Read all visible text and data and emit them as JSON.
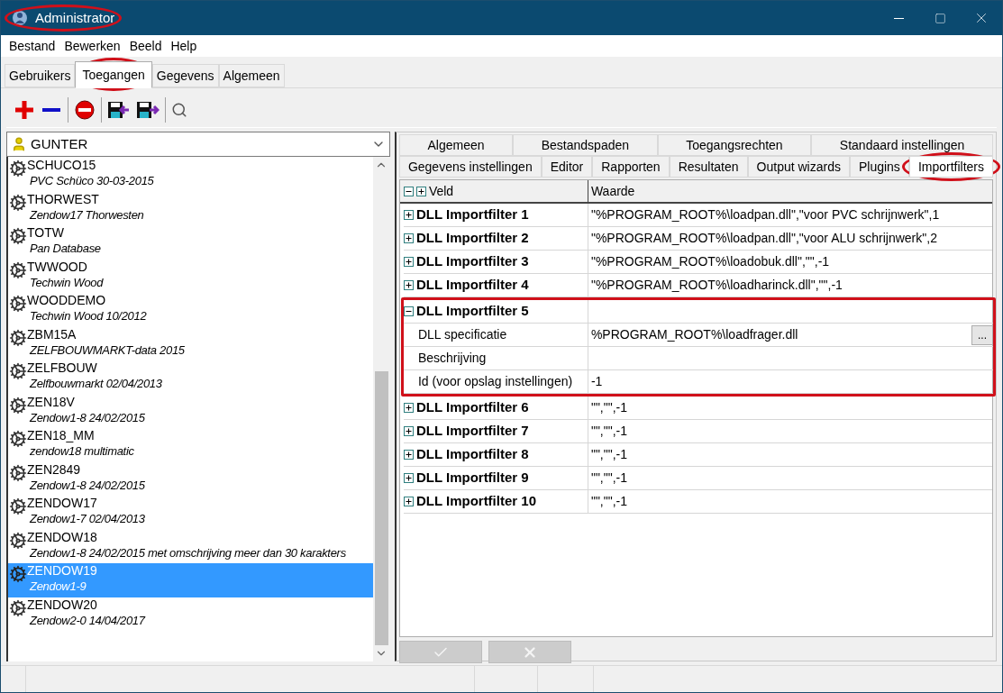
{
  "window": {
    "title": "Administrator",
    "highlighted": true
  },
  "menu": [
    "Bestand",
    "Bewerken",
    "Beeld",
    "Help"
  ],
  "tabs": [
    {
      "label": "Gebruikers",
      "selected": false,
      "highlighted": false
    },
    {
      "label": "Toegangen",
      "selected": true,
      "highlighted": true
    },
    {
      "label": "Gegevens",
      "selected": false,
      "highlighted": false
    },
    {
      "label": "Algemeen",
      "selected": false,
      "highlighted": false
    }
  ],
  "user_select": {
    "value": "GUNTER"
  },
  "list": [
    {
      "name": "SCHUCO15",
      "description": "PVC Schüco 30-03-2015",
      "selected": false
    },
    {
      "name": "THORWEST",
      "description": "Zendow17 Thorwesten",
      "selected": false
    },
    {
      "name": "TOTW",
      "description": "Pan Database",
      "selected": false
    },
    {
      "name": "TWWOOD",
      "description": "Techwin Wood",
      "selected": false
    },
    {
      "name": "WOODDEMO",
      "description": "Techwin Wood 10/2012",
      "selected": false
    },
    {
      "name": "ZBM15A",
      "description": "ZELFBOUWMARKT-data  2015",
      "selected": false
    },
    {
      "name": "ZELFBOUW",
      "description": "Zelfbouwmarkt 02/04/2013",
      "selected": false
    },
    {
      "name": "ZEN18V",
      "description": "Zendow1-8 24/02/2015",
      "selected": false
    },
    {
      "name": "ZEN18_MM",
      "description": "zendow18 multimatic",
      "selected": false
    },
    {
      "name": "ZEN2849",
      "description": "Zendow1-8 24/02/2015",
      "selected": false
    },
    {
      "name": "ZENDOW17",
      "description": "Zendow1-7 02/04/2013",
      "selected": false
    },
    {
      "name": "ZENDOW18",
      "description": "Zendow1-8 24/02/2015 met omschrijving meer dan 30 karakters",
      "selected": false
    },
    {
      "name": "ZENDOW19",
      "description": "Zendow1-9",
      "selected": true
    },
    {
      "name": "ZENDOW20",
      "description": "Zendow2-0 14/04/2017",
      "selected": false
    }
  ],
  "settings_tabs": [
    [
      {
        "label": "Algemeen",
        "selected": false,
        "highlighted": false
      },
      {
        "label": "Bestandspaden",
        "selected": false,
        "highlighted": false
      },
      {
        "label": "Toegangsrechten",
        "selected": false,
        "highlighted": false
      },
      {
        "label": "Standaard instellingen",
        "selected": false,
        "highlighted": false
      }
    ],
    [
      {
        "label": "Gegevens instellingen",
        "selected": false,
        "highlighted": false
      },
      {
        "label": "Editor",
        "selected": false,
        "highlighted": false
      },
      {
        "label": "Rapporten",
        "selected": false,
        "highlighted": false
      },
      {
        "label": "Resultaten",
        "selected": false,
        "highlighted": false
      },
      {
        "label": "Output wizards",
        "selected": false,
        "highlighted": false
      },
      {
        "label": "Plugins",
        "selected": false,
        "highlighted": false
      },
      {
        "label": "Importfilters",
        "selected": true,
        "highlighted": true
      }
    ]
  ],
  "grid": {
    "columns": [
      "Veld",
      "Waarde"
    ],
    "rows": [
      {
        "label": "DLL Importfilter 1",
        "value": "\"%PROGRAM_ROOT%\\loadpan.dll\",\"voor PVC schrijnwerk\",1",
        "expanded": false,
        "highlighted": false
      },
      {
        "label": "DLL Importfilter 2",
        "value": "\"%PROGRAM_ROOT%\\loadpan.dll\",\"voor ALU schrijnwerk\",2",
        "expanded": false,
        "highlighted": false
      },
      {
        "label": "DLL Importfilter 3",
        "value": "\"%PROGRAM_ROOT%\\loadobuk.dll\",\"\",-1",
        "expanded": false,
        "highlighted": false
      },
      {
        "label": "DLL Importfilter 4",
        "value": "\"%PROGRAM_ROOT%\\loadharinck.dll\",\"\",-1",
        "expanded": false,
        "highlighted": false
      },
      {
        "label": "DLL Importfilter 5",
        "expanded": true,
        "highlighted": true,
        "children": [
          {
            "label": "DLL specificatie",
            "value": "%PROGRAM_ROOT%\\loadfrager.dll",
            "button": "..."
          },
          {
            "label": "Beschrijving"
          },
          {
            "label": "Id (voor opslag instellingen)",
            "value": "-1"
          }
        ]
      },
      {
        "label": "DLL Importfilter 6",
        "value": "\"\",\"\",-1",
        "expanded": false,
        "highlighted": false
      },
      {
        "label": "DLL Importfilter 7",
        "value": "\"\",\"\",-1",
        "expanded": false,
        "highlighted": false
      },
      {
        "label": "DLL Importfilter 8",
        "value": "\"\",\"\",-1",
        "expanded": false,
        "highlighted": false
      },
      {
        "label": "DLL Importfilter 9",
        "value": "\"\",\"\",-1",
        "expanded": false,
        "highlighted": false
      },
      {
        "label": "DLL Importfilter 10",
        "value": "\"\",\"\",-1",
        "expanded": false,
        "highlighted": false
      }
    ]
  },
  "actions": [
    {
      "kind": "confirm",
      "disabled": true
    },
    {
      "kind": "cancel",
      "disabled": true
    }
  ]
}
